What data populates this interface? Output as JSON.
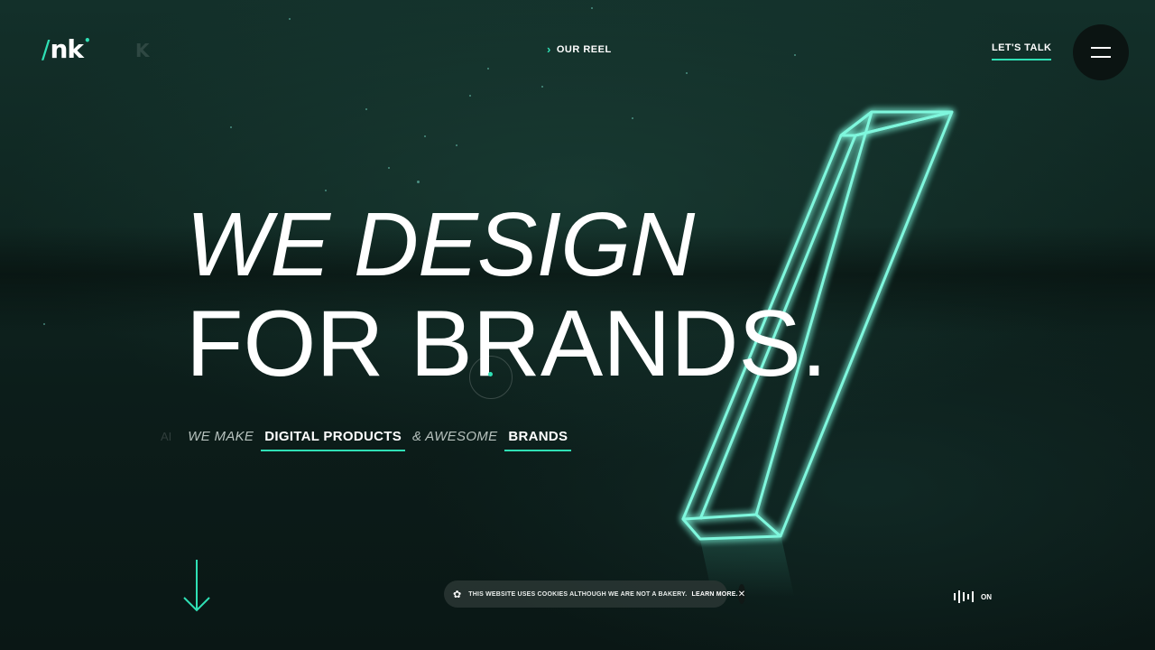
{
  "header": {
    "logo_text": "nk",
    "logo_slash": "/",
    "logo_ghost": "K",
    "reel_label": "OUR REEL",
    "talk_label": "LET'S TALK"
  },
  "hero": {
    "line1": "WE DESIGN",
    "line2": "FOR BRANDS",
    "period": "."
  },
  "subline": {
    "ghost": "AI",
    "prefix": "WE MAKE",
    "highlight1": "DIGITAL PRODUCTS",
    "middle": "& AWESOME",
    "highlight2": "BRANDS"
  },
  "cookie": {
    "text": "THIS WEBSITE USES COOKIES ALTHOUGH WE ARE NOT A BAKERY.",
    "link": "LEARN MORE.",
    "close": "✕"
  },
  "sound": {
    "label": "ON"
  },
  "colors": {
    "accent": "#2fe0b5",
    "background": "#0f2621",
    "text": "#ffffff"
  },
  "icons": [
    "chevron-right-icon",
    "menu-icon",
    "arrow-down-icon",
    "cookie-icon",
    "close-icon",
    "sound-wave-icon"
  ]
}
